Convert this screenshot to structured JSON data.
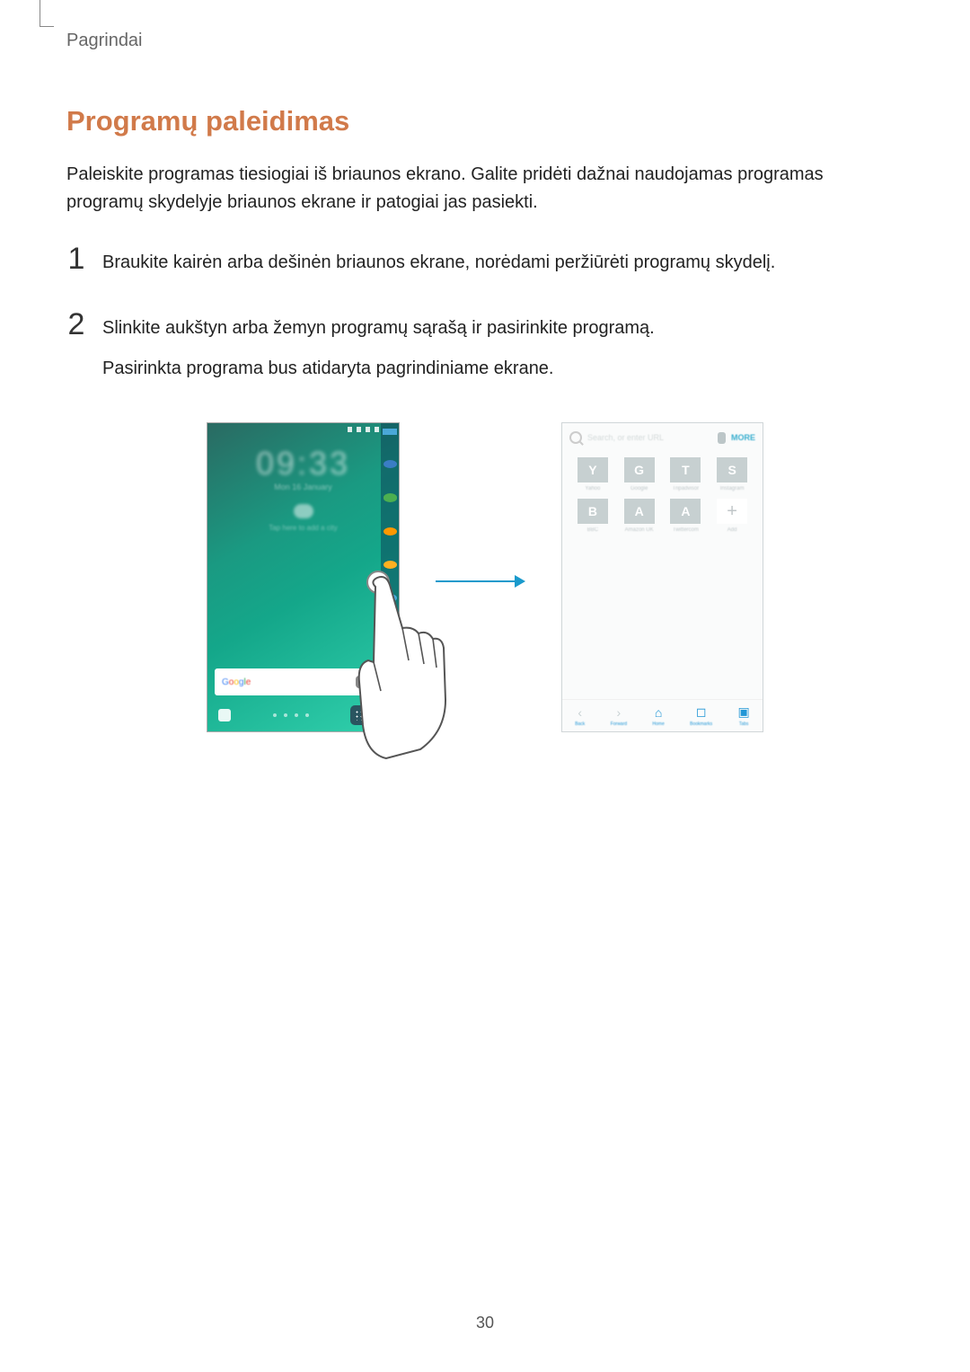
{
  "section": "Pagrindai",
  "heading": "Programų paleidimas",
  "intro": "Paleiskite programas tiesiogiai iš briaunos ekrano. Galite pridėti dažnai naudojamas programas programų skydelyje briaunos ekrane ir patogiai jas pasiekti.",
  "steps": {
    "s1": {
      "num": "1",
      "text": "Braukite kairėn arba dešinėn briaunos ekrane, norėdami peržiūrėti programų skydelį."
    },
    "s2": {
      "num": "2",
      "text": "Slinkite aukštyn arba žemyn programų sąrašą ir pasirinkite programą.",
      "sub": "Pasirinkta programa bus atidaryta pagrindiniame ekrane."
    }
  },
  "phone": {
    "time": "09:33",
    "date": "Mon 16 January",
    "weather": "Tap here to add a city",
    "search_label": "Google"
  },
  "browser": {
    "url_placeholder": "Search, or enter URL",
    "more": "MORE",
    "tiles": {
      "t0": {
        "l": "Y",
        "n": "Yahoo"
      },
      "t1": {
        "l": "G",
        "n": "Google"
      },
      "t2": {
        "l": "T",
        "n": "Tripadvisor"
      },
      "t3": {
        "l": "S",
        "n": "Instagram"
      },
      "t4": {
        "l": "B",
        "n": "BBC"
      },
      "t5": {
        "l": "A",
        "n": "Amazon UK"
      },
      "t6": {
        "l": "A",
        "n": "Twittercom"
      },
      "t7": {
        "l": "+",
        "n": "Add"
      }
    },
    "bottom": {
      "back": "Back",
      "forward": "Forward",
      "home": "Home",
      "bookmarks": "Bookmarks",
      "tabs": "Tabs"
    }
  },
  "page_number": "30"
}
